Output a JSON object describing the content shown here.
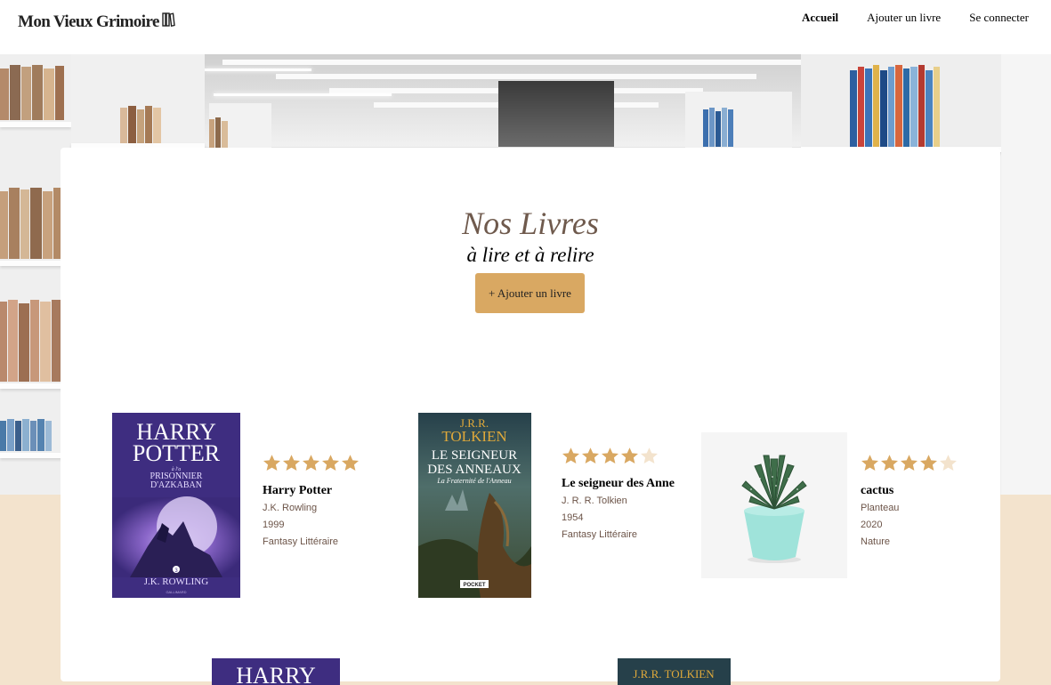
{
  "header": {
    "logo_text": "Mon Vieux Grimoire",
    "logo_icon": "books-icon",
    "nav": [
      {
        "label": "Accueil",
        "active": true
      },
      {
        "label": "Ajouter un livre",
        "active": false
      },
      {
        "label": "Se connecter",
        "active": false
      }
    ]
  },
  "main": {
    "title": "Nos Livres",
    "subtitle": "à lire et à relire",
    "add_button_label": "+ Ajouter un livre"
  },
  "books": [
    {
      "title": "Harry Potter",
      "author": "J.K. Rowling",
      "year": "1999",
      "genre": "Fantasy Littéraire",
      "rating": 5,
      "cover": {
        "line1": "HARRY",
        "line2": "POTTER",
        "line3": "à l'a",
        "line4": "PRISONNIER",
        "line5": "D'AZKABAN",
        "number": "3",
        "author": "J.K. ROWLING",
        "publisher": "GALLIMARD"
      }
    },
    {
      "title": "Le seigneur des Anne",
      "author": "J. R. R. Tolkien",
      "year": "1954",
      "genre": "Fantasy Littéraire",
      "rating": 4,
      "cover": {
        "line1": "J.R.R.",
        "line2": "TOLKIEN",
        "line3": "LE SEIGNEUR",
        "line4": "DES ANNEAUX",
        "line5": "La Fraternité de l'Anneau",
        "publisher": "POCKET"
      }
    },
    {
      "title": "cactus",
      "author": "Planteau",
      "year": "2020",
      "genre": "Nature",
      "rating": 4,
      "cover": {
        "image": "cactus-plant-image"
      }
    }
  ],
  "second_row": [
    {
      "cover_line": "HARRY"
    },
    {
      "cover_line": "J.R.R. TOLKIEN"
    }
  ],
  "colors": {
    "accent": "#d9a862",
    "title_brown": "#6f5a4d",
    "meta_brown": "#6c5448",
    "page_bg": "#f3e3cd",
    "star_full": "#d9a862",
    "star_empty": "#f3e3cd"
  }
}
